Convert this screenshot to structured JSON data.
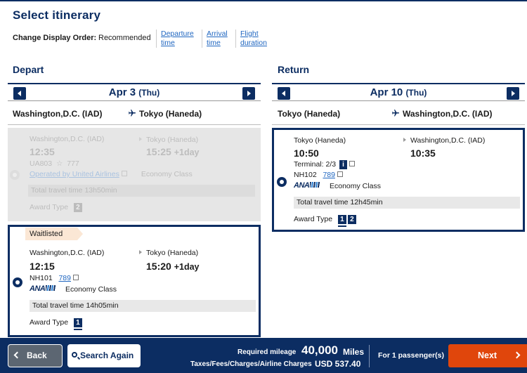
{
  "page": {
    "title": "Select itinerary",
    "sort_label": "Change Display Order:",
    "sort_current": "Recommended",
    "sort_links": [
      {
        "line1": "Departure",
        "line2": "time"
      },
      {
        "line1": "Arrival",
        "line2": "time"
      },
      {
        "line1": "Flight",
        "line2": "duration"
      }
    ]
  },
  "depart": {
    "heading": "Depart",
    "date": "Apr 3",
    "dow": "(Thu)",
    "from": "Washington,D.C. (IAD)",
    "to": "Tokyo (Haneda)",
    "flights": [
      {
        "status": "unavailable",
        "from": "Washington,D.C. (IAD)",
        "to": "Tokyo (Haneda)",
        "dep_time": "12:35",
        "arr_time": "15:25",
        "arr_offset": "+1day",
        "flight_no": "UA803",
        "aircraft": "777",
        "operated_by": "Operated by United Airlines",
        "cabin": "Economy Class",
        "total_travel_time": "Total travel time 13h50min",
        "award_type_label": "Award Type",
        "award_types": [
          "2"
        ]
      },
      {
        "status": "selected",
        "waitlisted": "Waitlisted",
        "from": "Washington,D.C. (IAD)",
        "to": "Tokyo (Haneda)",
        "dep_time": "12:15",
        "arr_time": "15:20",
        "arr_offset": "+1day",
        "flight_no": "NH101",
        "aircraft": "789",
        "airline_logo": "ANA",
        "cabin": "Economy Class",
        "total_travel_time": "Total travel time 14h05min",
        "award_type_label": "Award Type",
        "award_types": [
          "1"
        ]
      }
    ]
  },
  "return": {
    "heading": "Return",
    "date": "Apr 10",
    "dow": "(Thu)",
    "from": "Tokyo (Haneda)",
    "to": "Washington,D.C. (IAD)",
    "flights": [
      {
        "status": "selected",
        "from": "Tokyo (Haneda)",
        "to": "Washington,D.C. (IAD)",
        "dep_time": "10:50",
        "arr_time": "10:35",
        "terminal": "Terminal: 2/3",
        "flight_no": "NH102",
        "aircraft": "789",
        "airline_logo": "ANA",
        "cabin": "Economy Class",
        "total_travel_time": "Total travel time 12h45min",
        "award_type_label": "Award Type",
        "award_types": [
          "1",
          "2"
        ]
      }
    ]
  },
  "footer": {
    "back": "Back",
    "search_again": "Search Again",
    "mileage_label": "Required mileage",
    "mileage_value": "40,000",
    "mileage_unit": "Miles",
    "taxes_label": "Taxes/Fees/Charges/Airline Charges",
    "taxes_value": "USD  537.40",
    "passengers": "For 1 passenger(s)",
    "next": "Next"
  },
  "colors": {
    "brand_navy": "#0c2d62",
    "next_orange": "#e0460c",
    "link_blue": "#1f66c0",
    "waitlist_bg": "#fbe7d5"
  }
}
